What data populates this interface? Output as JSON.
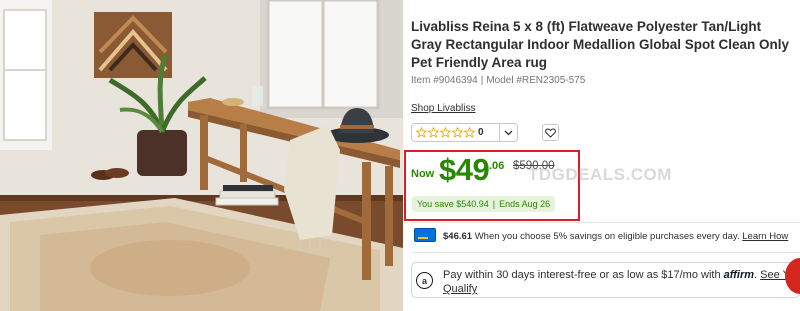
{
  "product": {
    "title": "Livabliss Reina 5 x 8 (ft) Flatweave Polyester Tan/Light Gray Rectangular Indoor Medallion Global Spot Clean Only Pet Friendly Area rug",
    "item_number": "Item #9046394",
    "separator": "|",
    "model_number": "Model #REN2305-575",
    "shop_link": "Shop Livabliss",
    "rating_count": "0",
    "image_icon": "product-photo"
  },
  "price": {
    "now_label": "Now",
    "dollars": "$49",
    "cents": ".06",
    "was": "$590.00",
    "savings": "You save $540.94",
    "savings_separator": "|",
    "ends": "Ends Aug 26"
  },
  "watermark": "TDGDEALS.COM",
  "walmart_plus": {
    "amount": "$46.61",
    "text": " When you choose 5% savings on eligible purchases every day. ",
    "link": "Learn How"
  },
  "affirm": {
    "icon_label": "a",
    "text_before": "Pay within 30 days interest-free or as low as $17/mo with ",
    "logo": "affirm",
    "text_after": ". ",
    "link": "See You Qualify"
  },
  "colors": {
    "price_green": "#2a8703",
    "highlight_red": "#de1c24",
    "savings_bg": "#e5f3dc",
    "walmart_blue": "#0071dc"
  }
}
